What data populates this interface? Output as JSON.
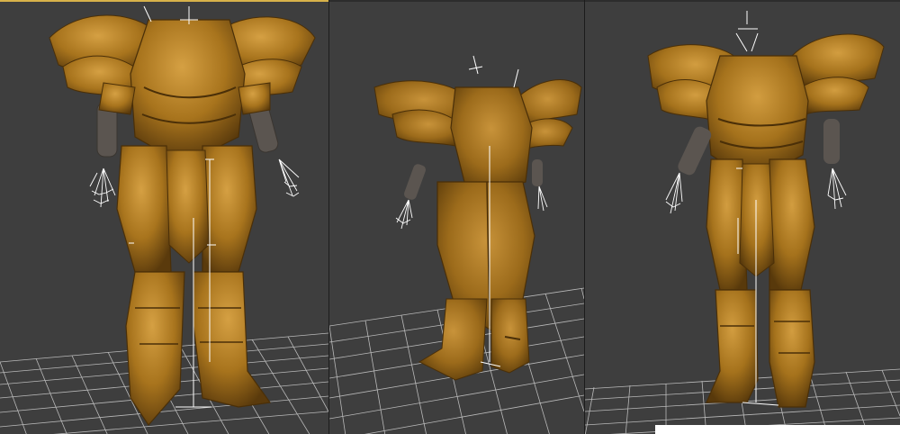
{
  "screen": {
    "description_hidden": "",
    "viewports": [
      {
        "id": "left",
        "active": true,
        "view": "front"
      },
      {
        "id": "middle",
        "active": false,
        "view": "back"
      },
      {
        "id": "right",
        "active": false,
        "view": "front"
      }
    ]
  },
  "colors": {
    "viewport_background": "#3e3e3e",
    "active_viewport_border": "#d8b24a",
    "grid_lines": "#cfcfcf",
    "armor_base": "#a8741d",
    "armor_dark": "#5a3a0c",
    "armor_highlight": "#d5a043",
    "bone_wire": "#ffffff",
    "chain_mail": "#5b5550"
  },
  "icons": [
    "grid-floor",
    "armor-model",
    "bone-skeleton",
    "hand-rig"
  ]
}
